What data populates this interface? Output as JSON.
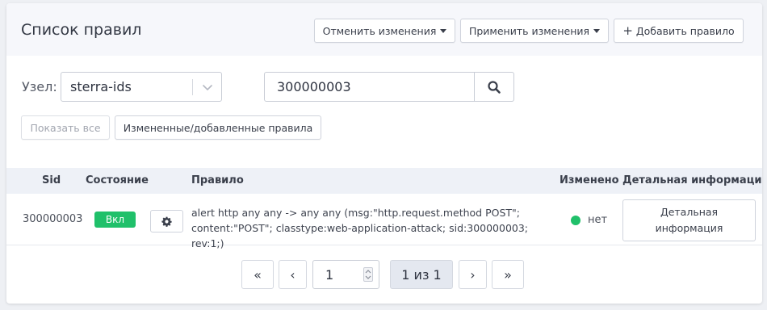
{
  "header": {
    "title": "Список правил",
    "discard_label": "Отменить изменения",
    "apply_label": "Применить изменения",
    "add_label": "Добавить правило",
    "add_icon": "plus-icon"
  },
  "filters": {
    "node_label": "Узел:",
    "node_value": "sterra-ids",
    "search_value": "300000003",
    "search_icon": "search-icon",
    "show_all_label": "Показать все",
    "changed_label": "Измененные/добавленные правила"
  },
  "table": {
    "columns": [
      "Sid",
      "Состояние",
      "Правило",
      "Изменено",
      "Детальная информация"
    ],
    "rows": [
      {
        "sid": "300000003",
        "state": "Вкл",
        "state_color": "#20c06a",
        "rule_line1": "alert http any any -> any any (msg:\"http.request.method POST\";",
        "rule_line2": "content:\"POST\"; classtype:web-application-attack; sid:300000003; rev:1;)",
        "changed": "нет",
        "changed_color": "#20c06a",
        "details_line1": "Детальная",
        "details_line2": "информация"
      }
    ]
  },
  "pagination": {
    "first": "«",
    "prev": "‹",
    "page_value": "1",
    "status": "1 из 1",
    "next": "›",
    "last": "»"
  },
  "colors": {
    "accent_green": "#20c06a",
    "header_bg": "#f6f7fb",
    "table_head_bg": "#eef1f7"
  }
}
